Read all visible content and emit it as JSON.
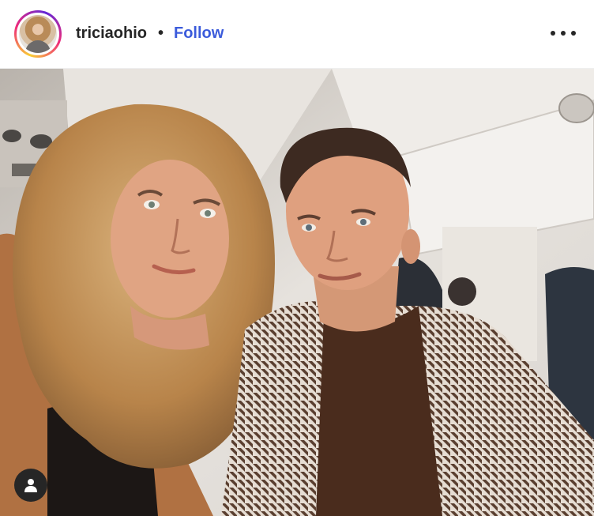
{
  "post": {
    "username": "triciaohio",
    "separator": "•",
    "follow_label": "Follow"
  },
  "icons": {
    "more": "more-options-icon",
    "tag": "user-tag-icon"
  },
  "colors": {
    "follow_link": "#3b5bdb",
    "text": "#262626"
  }
}
